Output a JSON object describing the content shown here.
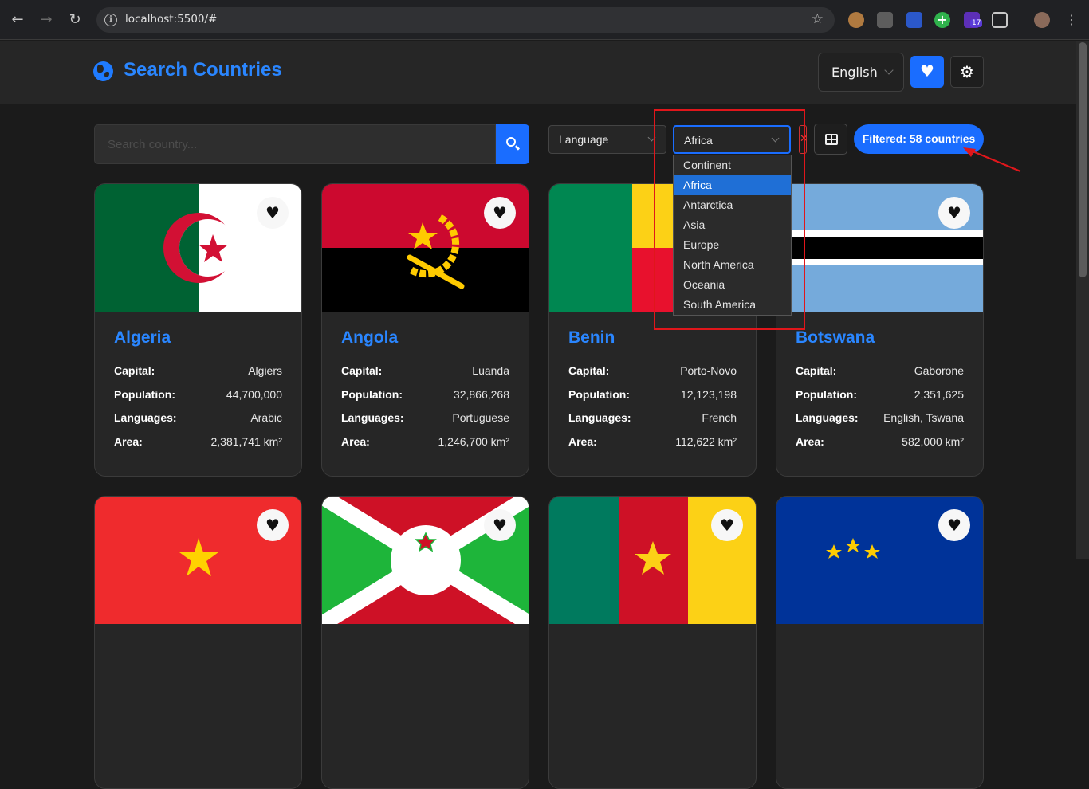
{
  "browser": {
    "url": "localhost:5500/#",
    "extension_badge": "17"
  },
  "header": {
    "title": "Search Countries",
    "language": "English"
  },
  "toolbar": {
    "search_placeholder": "Search country...",
    "language_filter": "Language",
    "continent_filter": "Africa",
    "filtered_badge": "Filtered: 58 countries"
  },
  "continent_dropdown": {
    "options": [
      "Continent",
      "Africa",
      "Antarctica",
      "Asia",
      "Europe",
      "North America",
      "Oceania",
      "South America"
    ],
    "selected": "Africa"
  },
  "labels": {
    "capital": "Capital:",
    "population": "Population:",
    "languages": "Languages:",
    "area": "Area:"
  },
  "countries": [
    {
      "name": "Algeria",
      "capital": "Algiers",
      "population": "44,700,000",
      "languages": "Arabic",
      "area": "2,381,741 km²"
    },
    {
      "name": "Angola",
      "capital": "Luanda",
      "population": "32,866,268",
      "languages": "Portuguese",
      "area": "1,246,700 km²"
    },
    {
      "name": "Benin",
      "capital": "Porto-Novo",
      "population": "12,123,198",
      "languages": "French",
      "area": "112,622 km²"
    },
    {
      "name": "Botswana",
      "capital": "Gaborone",
      "population": "2,351,625",
      "languages": "English, Tswana",
      "area": "582,000 km²"
    }
  ],
  "colors": {
    "accent": "#1a6dff",
    "title_blue": "#2a86ff",
    "background": "#1b1b1b",
    "card": "#262626",
    "annotation_red": "#e0161b"
  }
}
